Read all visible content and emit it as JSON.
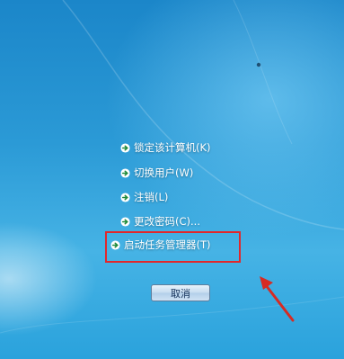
{
  "menu": {
    "items": [
      {
        "label": "锁定该计算机(K)"
      },
      {
        "label": "切换用户(W)"
      },
      {
        "label": "注销(L)"
      },
      {
        "label": "更改密码(C)..."
      },
      {
        "label": "启动任务管理器(T)"
      }
    ]
  },
  "cancel_button": {
    "label": "取消"
  },
  "colors": {
    "background": "#2b9ad6",
    "highlight_box": "#e2272b",
    "arrow_icon": "#1e8a3a"
  },
  "icons": {
    "menu_arrow": "arrow-right-circle-icon"
  }
}
